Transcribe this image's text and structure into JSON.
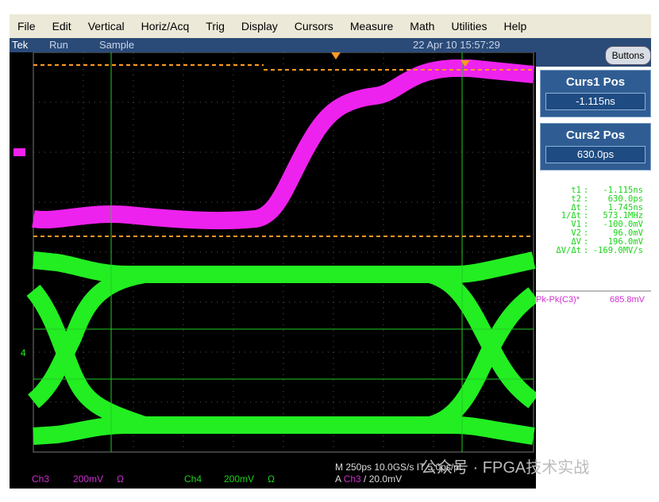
{
  "menu": [
    "File",
    "Edit",
    "Vertical",
    "Horiz/Acq",
    "Trig",
    "Display",
    "Cursors",
    "Measure",
    "Math",
    "Utilities",
    "Help"
  ],
  "status": {
    "brand": "Tek",
    "state": "Run",
    "mode": "Sample",
    "datetime": "22 Apr 10 15:57:29"
  },
  "buttons_label": "Buttons",
  "curs1": {
    "title": "Curs1 Pos",
    "value": "-1.115ns"
  },
  "curs2": {
    "title": "Curs2 Pos",
    "value": "630.0ps"
  },
  "readouts": [
    {
      "k": "t1",
      "v": "-1.115ns"
    },
    {
      "k": "t2",
      "v": "630.0ps"
    },
    {
      "k": "Δt",
      "v": "1.745ns"
    },
    {
      "k": "1/Δt",
      "v": "573.1MHz"
    },
    {
      "k": "V1",
      "v": "-100.0mV"
    },
    {
      "k": "V2",
      "v": "96.0mV"
    },
    {
      "k": "ΔV",
      "v": "196.0mV"
    },
    {
      "k": "ΔV/Δt",
      "v": "-169.0MV/s"
    }
  ],
  "measurement": {
    "label": "Pk-Pk(C3)*",
    "value": "685.8mV"
  },
  "channels": [
    {
      "name": "Ch3",
      "scale": "200mV",
      "term": "Ω",
      "color": "#d02ed0"
    },
    {
      "name": "Ch4",
      "scale": "200mV",
      "term": "Ω",
      "color": "#19d419"
    }
  ],
  "timebase": "M 250ps 10.0GS/s   IT 5.0ps/pt",
  "trigger": {
    "prefix": "A",
    "source": "Ch3",
    "slope": "/",
    "level": "20.0mV"
  },
  "ch4_marker": "4",
  "watermark": "公众号 · FPGA技术实战"
}
